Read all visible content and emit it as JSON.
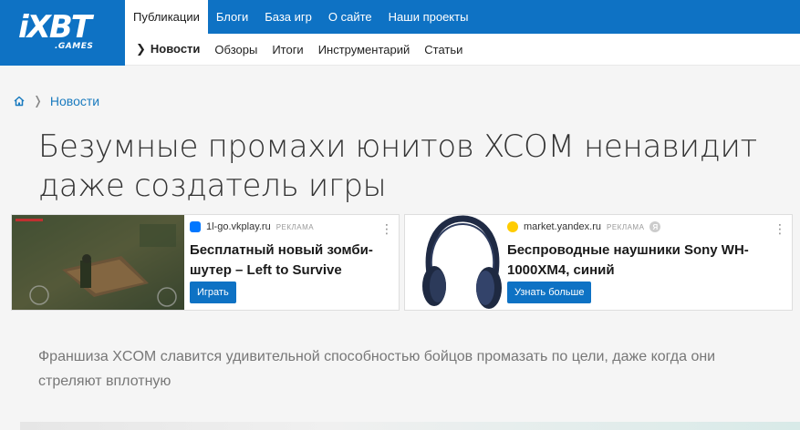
{
  "logo": {
    "main": "iXBT",
    "sub": ".GAMES"
  },
  "topnav": [
    {
      "label": "Публикации",
      "active": true
    },
    {
      "label": "Блоги",
      "active": false
    },
    {
      "label": "База игр",
      "active": false
    },
    {
      "label": "О сайте",
      "active": false
    },
    {
      "label": "Наши проекты",
      "active": false
    }
  ],
  "subnav": [
    {
      "label": "Новости",
      "active": true
    },
    {
      "label": "Обзоры"
    },
    {
      "label": "Итоги"
    },
    {
      "label": "Инструментарий"
    },
    {
      "label": "Статьи"
    }
  ],
  "breadcrumb": {
    "home_icon": "home-icon",
    "current": "Новости"
  },
  "article": {
    "title": "Безумные промахи юнитов XCOM ненавидит даже создатель игры",
    "lead": "Франшиза XCOM славится удивительной способностью бойцов промазать по цели, даже когда они стреляют вплотную"
  },
  "ads": [
    {
      "source": "1l-go.vkplay.ru",
      "tag": "РЕКЛАМА",
      "favicon_color": "#0077ff",
      "title": "Бесплатный новый зомби-шутер – Left to Survive",
      "button": "Играть"
    },
    {
      "source": "market.yandex.ru",
      "tag": "РЕКЛАМА",
      "favicon_color": "#ffcc00",
      "title": "Беспроводные наушники Sony WH-1000XM4, синий",
      "button": "Узнать больше"
    }
  ],
  "colors": {
    "brand": "#0e72c4",
    "link": "#1a7bbf"
  }
}
